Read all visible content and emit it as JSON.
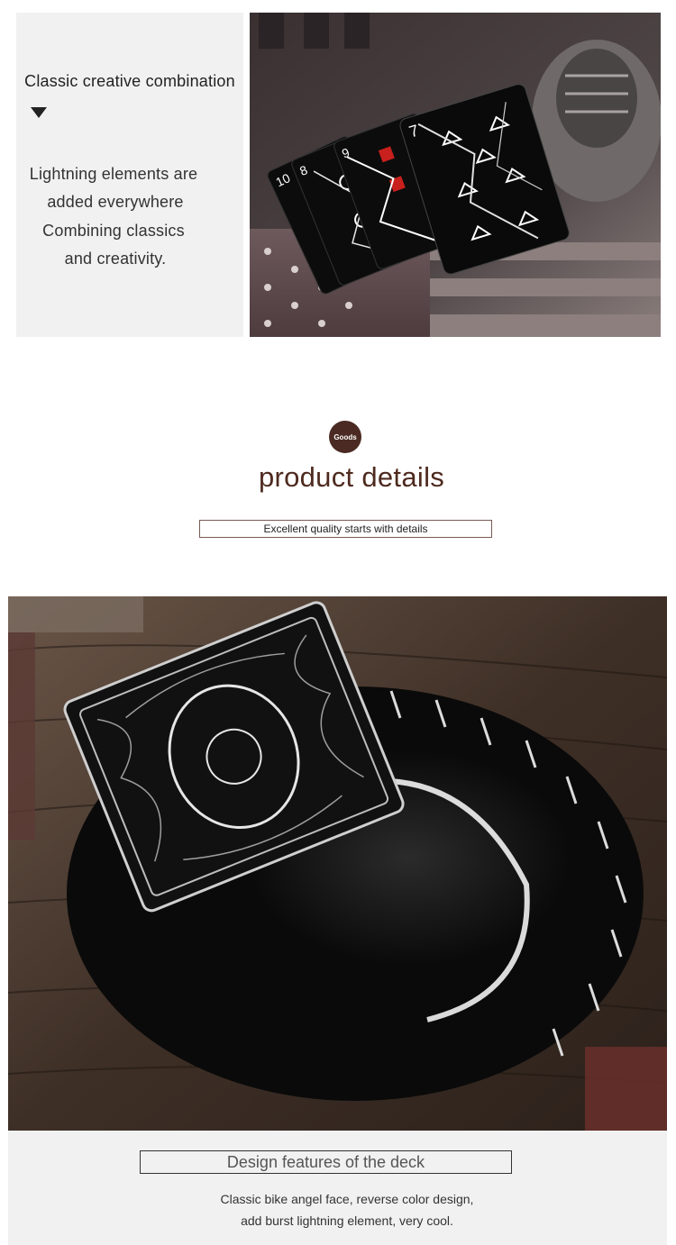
{
  "intro": {
    "heading": "Classic creative combination",
    "lines": [
      "Lightning elements are",
      "added everywhere",
      "Combining classics",
      "and creativity."
    ]
  },
  "section": {
    "badge": "Goods",
    "title": "product details",
    "subtitle": "Excellent quality starts with details"
  },
  "features": {
    "heading": "Design features of the deck",
    "lines": [
      "Classic bike angel face, reverse color design,",
      "add burst lightning element, very cool."
    ]
  },
  "colors": {
    "brand_brown": "#4e2a1f",
    "panel_gray": "#f1f1f1"
  }
}
